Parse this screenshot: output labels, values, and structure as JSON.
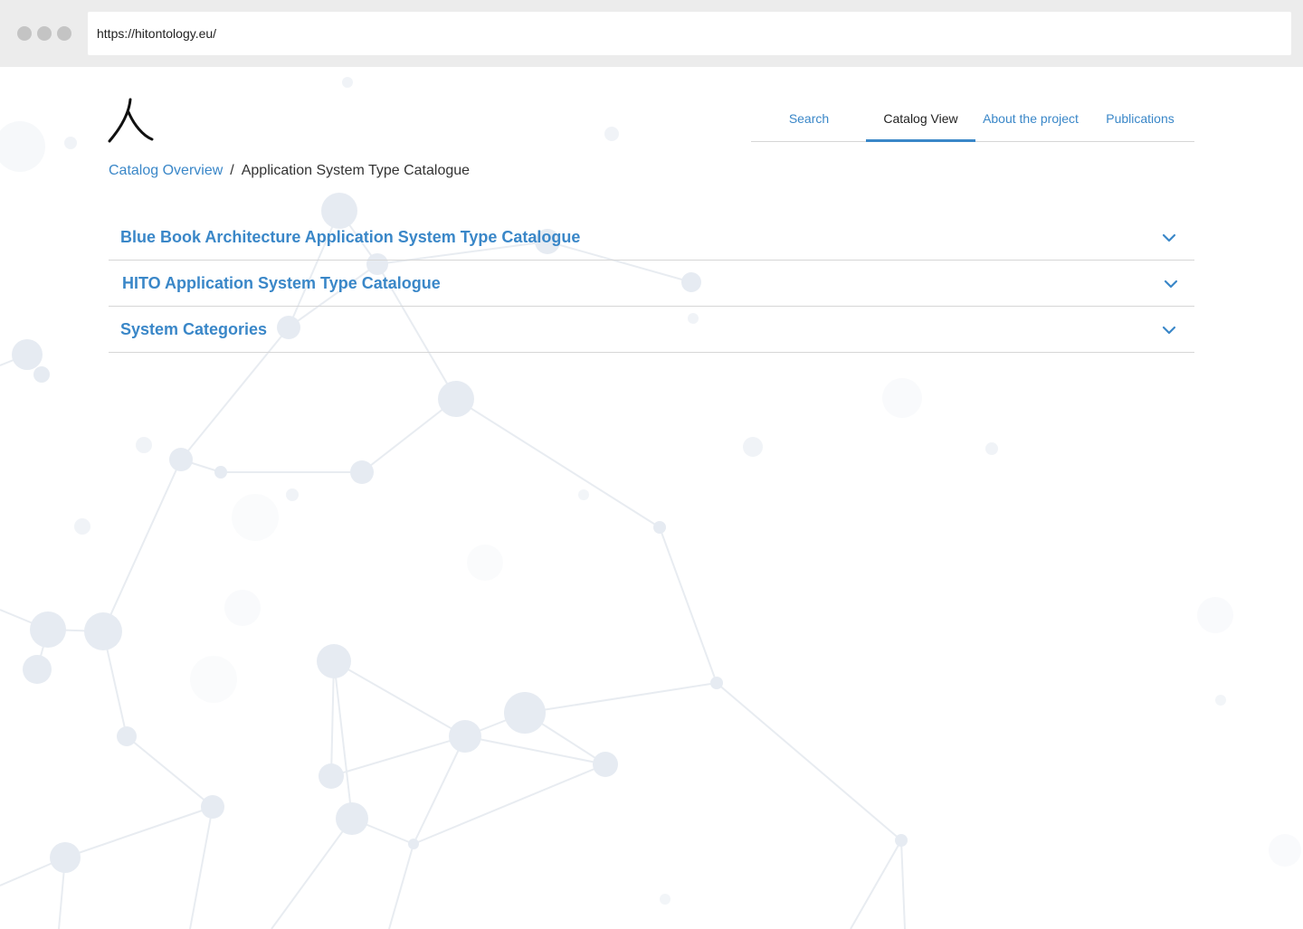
{
  "browser": {
    "url": "https://hitontology.eu/"
  },
  "logo": {
    "glyph": "人"
  },
  "nav": {
    "items": [
      {
        "label": "Search",
        "active": false
      },
      {
        "label": "Catalog View",
        "active": true
      },
      {
        "label": "About the project",
        "active": false
      },
      {
        "label": "Publications",
        "active": false
      }
    ]
  },
  "breadcrumb": {
    "parent": "Catalog Overview",
    "separator": "/",
    "current": "Application System Type Catalogue"
  },
  "accordion": {
    "items": [
      {
        "title": "Blue Book Architecture Application System Type Catalogue",
        "icon": "chevron-down-icon"
      },
      {
        "title": "HITO Application System Type Catalogue",
        "icon": "chevron-down-icon"
      },
      {
        "title": "System Categories",
        "icon": "chevron-down-icon"
      }
    ]
  },
  "colors": {
    "accent": "#3a87c8",
    "chrome": "#ececec",
    "divider": "#d6d6d6",
    "network": "#e3e9f1"
  }
}
